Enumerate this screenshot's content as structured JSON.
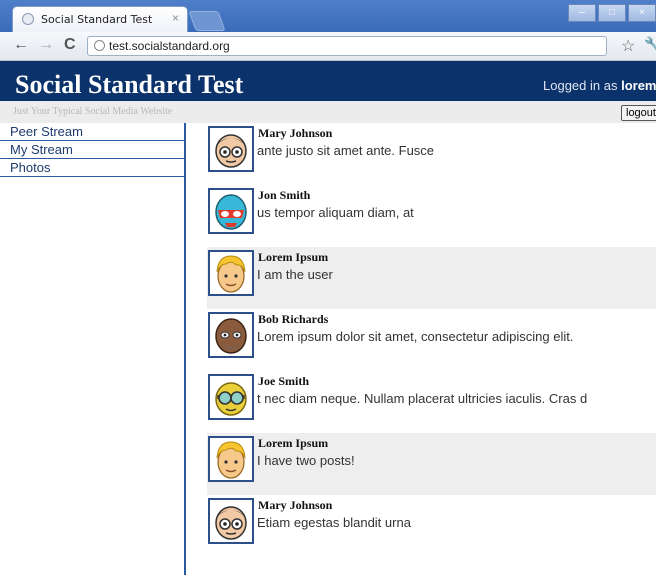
{
  "browser": {
    "tab_title": "Social Standard Test",
    "tab_close": "×",
    "url": "test.socialstandard.org",
    "window_buttons": [
      "–",
      "□",
      "×"
    ]
  },
  "site": {
    "title": "Social Standard Test",
    "tagline": "Just Your Typical Social Media Website",
    "logged_in_prefix": "Logged in as",
    "username": "lorem",
    "logout_label": "logout"
  },
  "sidebar": {
    "items": [
      {
        "label": "Peer Stream"
      },
      {
        "label": "My Stream"
      },
      {
        "label": "Photos"
      }
    ]
  },
  "stream": {
    "posts": [
      {
        "author": "Mary Johnson",
        "text": "ante justo sit amet ante. Fusce",
        "avatar": "nerd-glasses-avatar",
        "highlight": false
      },
      {
        "author": "Jon Smith",
        "text": "us tempor aliquam diam, at",
        "avatar": "masked-wrestler-avatar",
        "highlight": false
      },
      {
        "author": "Lorem Ipsum",
        "text": "I am the user",
        "avatar": "blonde-user-avatar",
        "highlight": true
      },
      {
        "author": "Bob Richards",
        "text": "Lorem ipsum dolor sit amet, consectetur adipiscing elit.",
        "avatar": "bald-bearded-avatar",
        "highlight": false
      },
      {
        "author": "Joe Smith",
        "text": "t nec diam neque. Nullam placerat ultricies iaculis. Cras d",
        "avatar": "goggles-avatar",
        "highlight": false
      },
      {
        "author": "Lorem Ipsum",
        "text": "I have two posts!",
        "avatar": "blonde-user-avatar",
        "highlight": true
      },
      {
        "author": "Mary Johnson",
        "text": "Etiam egestas blandit urna",
        "avatar": "nerd-glasses-avatar",
        "highlight": false
      }
    ]
  },
  "colors": {
    "header_bg": "#0b326b",
    "sidebar_border": "#2c5aa0",
    "highlight_row": "#eeeeee"
  }
}
